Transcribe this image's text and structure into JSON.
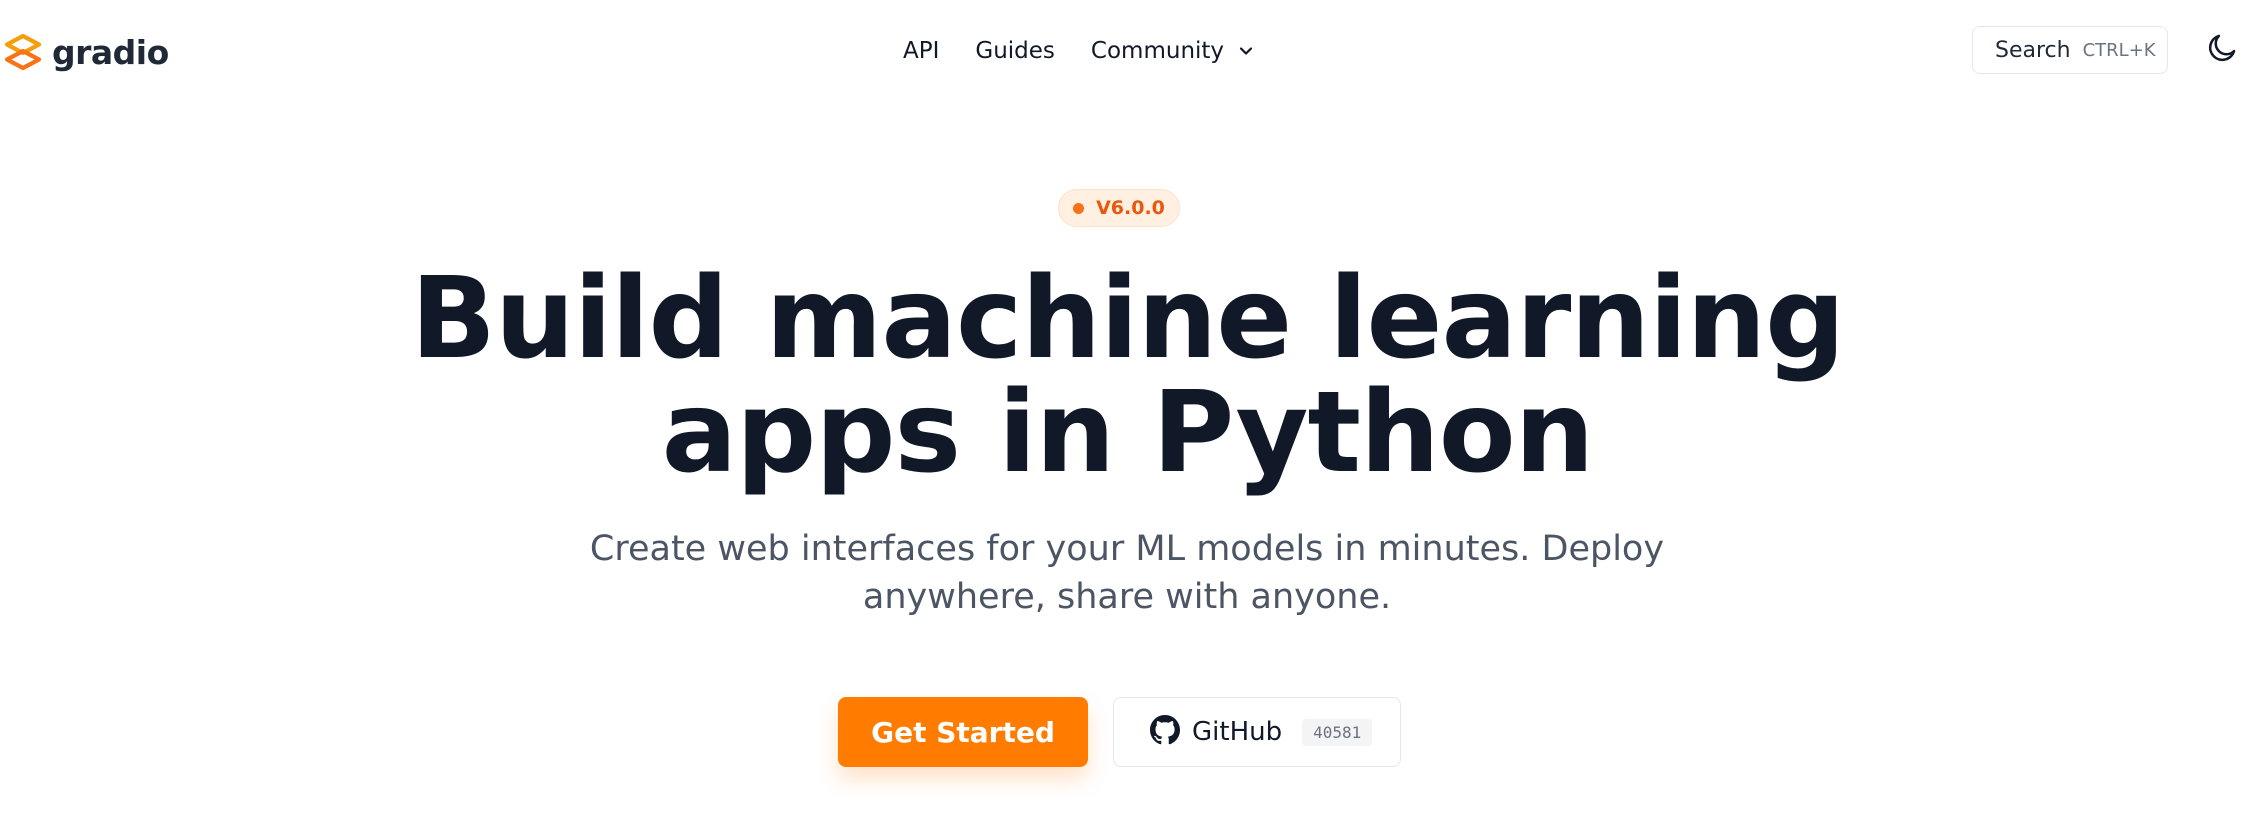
{
  "header": {
    "logo_text": "gradio",
    "logo_icon": "gradio-logo-icon",
    "nav": [
      {
        "label": "API"
      },
      {
        "label": "Guides"
      },
      {
        "label": "Community",
        "icon": "chevron-down-icon"
      }
    ],
    "search": {
      "label": "Search",
      "shortcut": "CTRL+K"
    },
    "theme_toggle_icon": "moon-icon"
  },
  "hero": {
    "badge": "V6.0.0",
    "headline_line1": "Build machine learning",
    "headline_line2": "apps in Python",
    "subtitle_line1": "Create web interfaces for your ML models in minutes. Deploy",
    "subtitle_line2": "anywhere, share with anyone.",
    "primary_button": "Get Started",
    "github_button": {
      "label": "GitHub",
      "stars": "40581",
      "icon": "github-icon"
    }
  },
  "colors": {
    "accent": "#ff7c00",
    "badge_bg": "#fff0e2",
    "badge_text": "#ea580c",
    "headline": "#111827",
    "subtitle": "#4b5563"
  }
}
